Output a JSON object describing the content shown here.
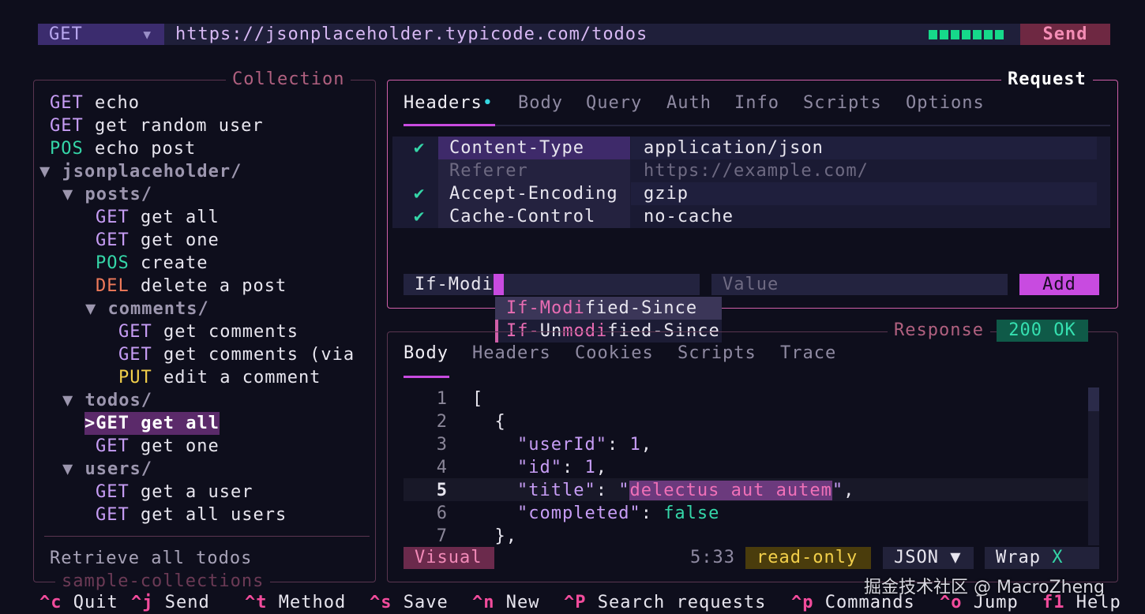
{
  "urlbar": {
    "method": "GET",
    "method_chevron": "▼",
    "url": "https://jsonplaceholder.typicode.com/todos",
    "send_label": "Send",
    "progress_fraction": 1.0
  },
  "collection": {
    "title": "Collection",
    "footer_title": "sample-collections",
    "description": "Retrieve all todos",
    "items": [
      {
        "method": "GET",
        "label": "echo"
      },
      {
        "method": "GET",
        "label": "get random user"
      },
      {
        "method": "POS",
        "label": "echo post"
      },
      {
        "folder": "▼ jsonplaceholder/"
      },
      {
        "folder": "▼ posts/"
      },
      {
        "method": "GET",
        "label": "get all"
      },
      {
        "method": "GET",
        "label": "get one"
      },
      {
        "method": "POS",
        "label": "create"
      },
      {
        "method": "DEL",
        "label": "delete a post"
      },
      {
        "folder": "▼ comments/"
      },
      {
        "method": "GET",
        "label": "get comments"
      },
      {
        "method": "GET",
        "label": "get comments (via"
      },
      {
        "method": "PUT",
        "label": "edit a comment"
      },
      {
        "folder": "▼ todos/"
      },
      {
        "selected": ">GET get all"
      },
      {
        "method": "GET",
        "label": "get one"
      },
      {
        "folder": "▼ users/"
      },
      {
        "method": "GET",
        "label": "get a user"
      },
      {
        "method": "GET",
        "label": "get all users"
      }
    ]
  },
  "request": {
    "title": "Request",
    "tabs": [
      "Headers",
      "Body",
      "Query",
      "Auth",
      "Info",
      "Scripts",
      "Options"
    ],
    "tab_dot": "•",
    "headers": [
      {
        "check": "✔",
        "key": "Content-Type",
        "value": "application/json"
      },
      {
        "check": "",
        "key": "Referer",
        "value": "https://example.com/"
      },
      {
        "check": "✔",
        "key": "Accept-Encoding",
        "value": "gzip"
      },
      {
        "check": "✔",
        "key": "Cache-Control",
        "value": "no-cache"
      }
    ],
    "new_key_value": "If-Modi",
    "new_value_placeholder": "Value",
    "add_label": "Add",
    "autocomplete": [
      {
        "pre": "If-Modi",
        "post": "fied-Since"
      },
      {
        "pre": "If-",
        "mid": "Un",
        "hl": "modi",
        "post": "fied-Since"
      }
    ]
  },
  "response": {
    "title": "Response",
    "status": "200 OK",
    "tabs": [
      "Body",
      "Headers",
      "Cookies",
      "Scripts",
      "Trace"
    ],
    "lines": [
      "1",
      "2",
      "3",
      "4",
      "5",
      "6",
      "7"
    ],
    "code": {
      "l1": "[",
      "l2": "  {",
      "k3": "\"userId\"",
      "v3": "1",
      "k4": "\"id\"",
      "v4": "1",
      "k5": "\"title\"",
      "v5": "delectus aut autem",
      "k6": "\"completed\"",
      "v6": "false",
      "l7": "  },"
    },
    "mode": "Visual",
    "cursor": "5:33",
    "readonly": "read-only",
    "lang": "JSON ▼",
    "wrap": "Wrap",
    "wrap_state": "X"
  },
  "footer": [
    {
      "key": "^c",
      "label": "Quit"
    },
    {
      "key": "^j",
      "label": "Send"
    },
    {
      "key": "^t",
      "label": "Method"
    },
    {
      "key": "^s",
      "label": "Save"
    },
    {
      "key": "^n",
      "label": "New"
    },
    {
      "key": "^P",
      "label": "Search requests"
    },
    {
      "key": "^p",
      "label": "Commands"
    },
    {
      "key": "^o",
      "label": "Jump"
    },
    {
      "key": "f1",
      "label": "Help"
    }
  ],
  "watermark": "掘金技术社区 @ MacroZheng",
  "colors": {
    "accent": "#c84be0",
    "panel_border": "#d05fa8",
    "ok": "#16d98a",
    "get": "#c79df5",
    "post": "#35d6a8",
    "delete": "#f07a5a",
    "put": "#f2cf4a"
  }
}
